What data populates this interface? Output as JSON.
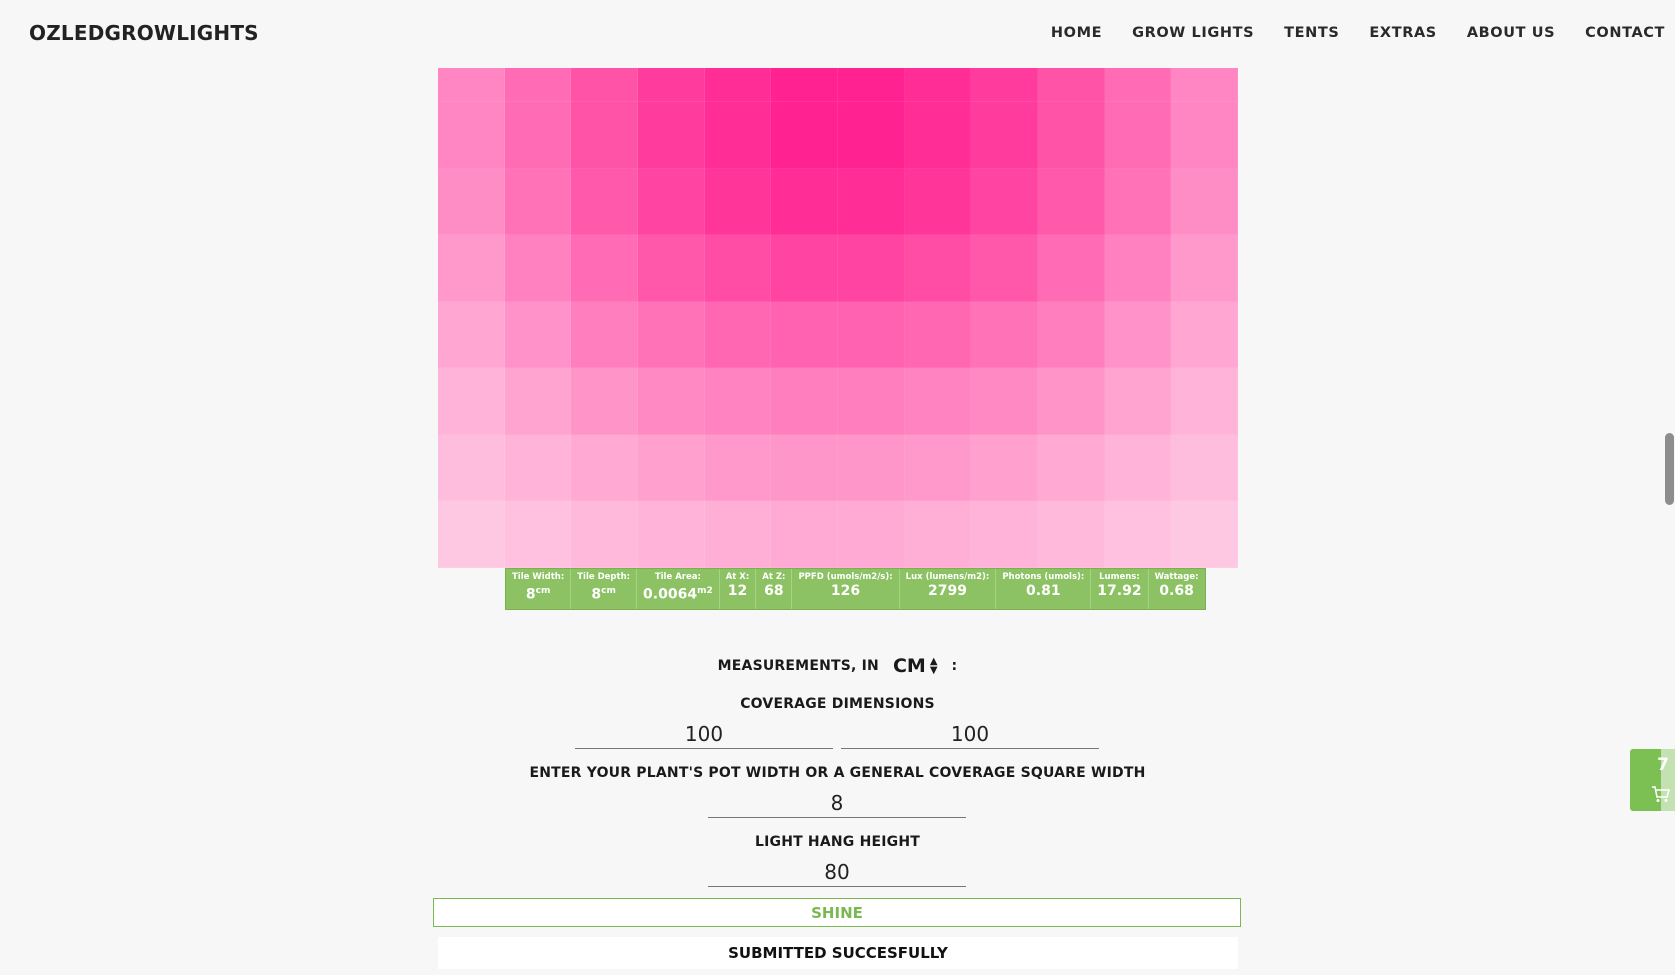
{
  "header": {
    "logo": "OZLEDGROWLIGHTS",
    "nav": [
      "HOME",
      "GROW LIGHTS",
      "TENTS",
      "EXTRAS",
      "ABOUT US",
      "CONTACT"
    ]
  },
  "heatmap": {
    "colors": {
      "hot": "#ff1f8e",
      "cool": "#ffcbe4"
    },
    "intensity": [
      [
        0.4,
        0.56,
        0.7,
        0.83,
        0.92,
        0.98,
        0.98,
        0.92,
        0.83,
        0.7,
        0.56,
        0.4
      ],
      [
        0.4,
        0.56,
        0.7,
        0.83,
        0.92,
        0.98,
        0.98,
        0.92,
        0.83,
        0.7,
        0.56,
        0.4
      ],
      [
        0.36,
        0.52,
        0.66,
        0.78,
        0.87,
        0.92,
        0.92,
        0.87,
        0.78,
        0.66,
        0.52,
        0.36
      ],
      [
        0.29,
        0.43,
        0.56,
        0.67,
        0.74,
        0.78,
        0.78,
        0.74,
        0.67,
        0.56,
        0.43,
        0.29
      ],
      [
        0.21,
        0.33,
        0.44,
        0.52,
        0.58,
        0.61,
        0.61,
        0.58,
        0.52,
        0.44,
        0.33,
        0.21
      ],
      [
        0.14,
        0.23,
        0.32,
        0.38,
        0.42,
        0.45,
        0.45,
        0.42,
        0.38,
        0.32,
        0.23,
        0.14
      ],
      [
        0.08,
        0.14,
        0.2,
        0.25,
        0.29,
        0.31,
        0.31,
        0.29,
        0.25,
        0.2,
        0.14,
        0.08
      ],
      [
        0.02,
        0.06,
        0.1,
        0.14,
        0.17,
        0.19,
        0.19,
        0.17,
        0.14,
        0.1,
        0.06,
        0.02
      ]
    ]
  },
  "stats": {
    "tile_width_label": "Tile Width:",
    "tile_width_value": "8",
    "tile_width_unit": "cm",
    "tile_depth_label": "Tile Depth:",
    "tile_depth_value": "8",
    "tile_depth_unit": "cm",
    "tile_area_label": "Tile Area:",
    "tile_area_value": "0.0064",
    "tile_area_unit": "m2",
    "at_x_label": "At X:",
    "at_x_value": "12",
    "at_z_label": "At Z:",
    "at_z_value": "68",
    "ppfd_label": "PPFD (umols/m2/s):",
    "ppfd_value": "126",
    "lux_label": "Lux (lumens/m2):",
    "lux_value": "2799",
    "photons_label": "Photons (umols):",
    "photons_value": "0.81",
    "lumens_label": "Lumens:",
    "lumens_value": "17.92",
    "wattage_label": "Wattage:",
    "wattage_value": "0.68"
  },
  "form": {
    "measurements_label": "MEASUREMENTS, IN",
    "unit": "CM",
    "colon": ":",
    "coverage_label": "COVERAGE DIMENSIONS",
    "coverage_width": "100",
    "coverage_depth": "100",
    "pot_label": "ENTER YOUR PLANT'S POT WIDTH OR A GENERAL COVERAGE SQUARE WIDTH",
    "pot_width": "8",
    "hang_label": "LIGHT HANG HEIGHT",
    "hang_height": "80",
    "shine_button": "SHINE",
    "status": "SUBMITTED SUCCESFULLY"
  },
  "cart": {
    "count": "7"
  },
  "accent_green": "#7cbf52"
}
